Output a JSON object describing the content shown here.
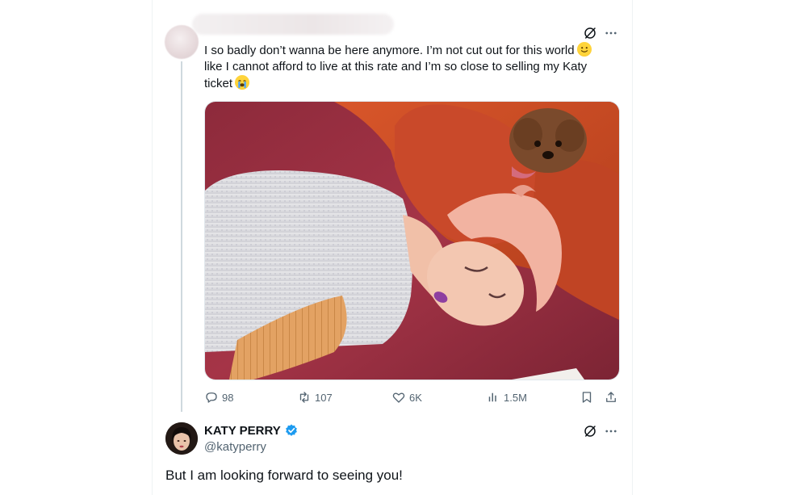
{
  "quoted_tweet": {
    "text_line1": "I so badly don’t wanna be here anymore. I’m not cut out for this world",
    "text_line2": "like I cannot afford to live at this rate and I’m so close to selling my Katy",
    "text_line3": "ticket",
    "emoji1": "slightly-smiling-face",
    "emoji2": "loudly-crying-face",
    "media_icon": "photo-person-lying-on-carpet-with-dog"
  },
  "actions": {
    "replies": "98",
    "reposts": "107",
    "likes": "6K",
    "views": "1.5M"
  },
  "reply": {
    "name": "KATY PERRY",
    "handle": "@katyperry",
    "text": "But I am looking forward to seeing you!",
    "verified_color": "#1d9bf0"
  },
  "colors": {
    "text_primary": "#0f1419",
    "text_secondary": "#536471",
    "verified": "#1d9bf0"
  }
}
